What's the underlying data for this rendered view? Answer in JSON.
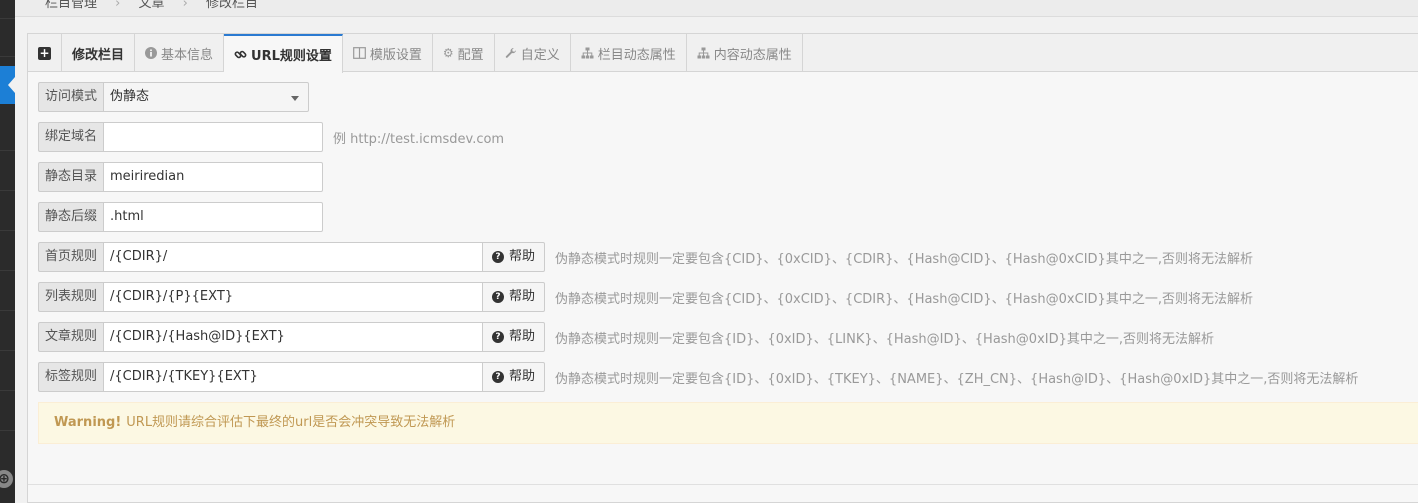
{
  "breadcrumb": [
    "栏目管理",
    "文章",
    "修改栏目"
  ],
  "tabs": [
    {
      "label": "",
      "icon": "plus-square-icon"
    },
    {
      "label": "修改栏目",
      "icon": ""
    },
    {
      "label": "基本信息",
      "icon": "info-circle-icon"
    },
    {
      "label": "URL规则设置",
      "icon": "link-icon",
      "active": true
    },
    {
      "label": "模版设置",
      "icon": "columns-icon"
    },
    {
      "label": "配置",
      "icon": "gear-icon"
    },
    {
      "label": "自定义",
      "icon": "wrench-icon"
    },
    {
      "label": "栏目动态属性",
      "icon": "sitemap-icon"
    },
    {
      "label": "内容动态属性",
      "icon": "sitemap-icon"
    }
  ],
  "form": {
    "mode": {
      "label": "访问模式",
      "value": "伪静态"
    },
    "domain": {
      "label": "绑定域名",
      "value": "",
      "hint": "例 http://test.icmsdev.com"
    },
    "dir": {
      "label": "静态目录",
      "value": "meiriredian"
    },
    "suffix": {
      "label": "静态后缀",
      "value": ".html"
    },
    "rules": [
      {
        "label": "首页规则",
        "value": "/{CDIR}/",
        "help": "帮助",
        "hint": "伪静态模式时规则一定要包含{CID}、{0xCID}、{CDIR}、{Hash@CID}、{Hash@0xCID}其中之一,否则将无法解析"
      },
      {
        "label": "列表规则",
        "value": "/{CDIR}/{P}{EXT}",
        "help": "帮助",
        "hint": "伪静态模式时规则一定要包含{CID}、{0xCID}、{CDIR}、{Hash@CID}、{Hash@0xCID}其中之一,否则将无法解析"
      },
      {
        "label": "文章规则",
        "value": "/{CDIR}/{Hash@ID}{EXT}",
        "help": "帮助",
        "hint": "伪静态模式时规则一定要包含{ID}、{0xID}、{LINK}、{Hash@ID}、{Hash@0xID}其中之一,否则将无法解析"
      },
      {
        "label": "标签规则",
        "value": "/{CDIR}/{TKEY}{EXT}",
        "help": "帮助",
        "hint": "伪静态模式时规则一定要包含{ID}、{0xID}、{TKEY}、{NAME}、{ZH_CN}、{Hash@ID}、{Hash@0xID}其中之一,否则将无法解析"
      }
    ]
  },
  "warning": {
    "title": "Warning!",
    "text": "URL规则请综合评估下最终的url是否会冲突导致无法解析"
  },
  "colors": {
    "accent": "#2a7ad1",
    "sidebar_active": "#1c7fd6",
    "warning_bg": "#fcf8e3",
    "warning_text": "#c09853"
  }
}
